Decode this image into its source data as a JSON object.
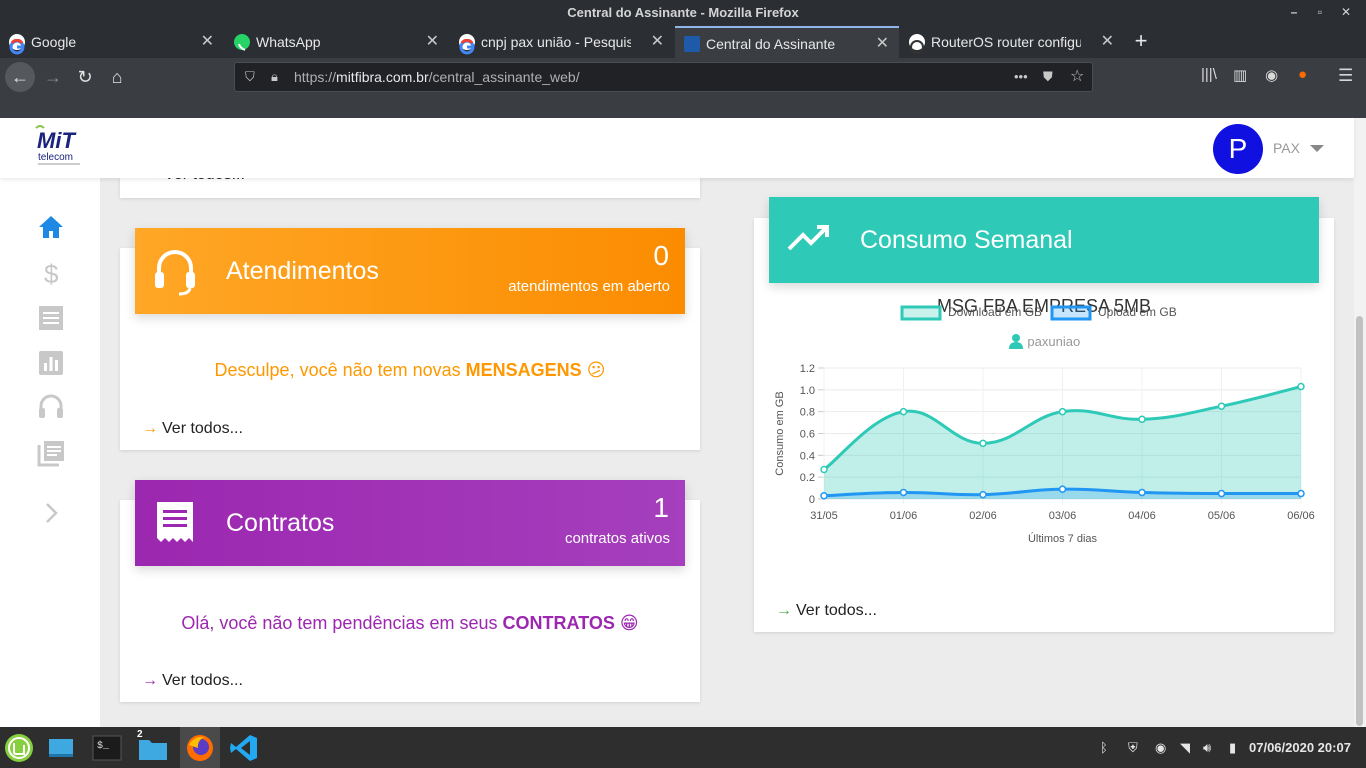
{
  "window": {
    "title": "Central do Assinante - Mozilla Firefox"
  },
  "tabs": [
    {
      "label": "Google",
      "favicon": "google-icon"
    },
    {
      "label": "WhatsApp",
      "favicon": "whatsapp-icon"
    },
    {
      "label": "cnpj pax união - Pesquisa G",
      "favicon": "google-icon"
    },
    {
      "label": "Central do Assinante",
      "favicon": "mitfibra-icon",
      "active": true
    },
    {
      "label": "RouterOS router configura",
      "favicon": "mikrotik-icon"
    }
  ],
  "url": {
    "scheme": "https://",
    "domain": "mitfibra.com.br",
    "path": "/central_assinante_web/"
  },
  "header": {
    "avatar_letter": "P",
    "username": "PAX",
    "logo_text": "MiT",
    "logo_sub": "telecom"
  },
  "colors": {
    "orange": "#ff9800",
    "purple": "#9c27b0",
    "teal": "#2ec9b7",
    "blue_upload": "#2196f3",
    "avatar": "#1010e0"
  },
  "top_card": {
    "link": "Ver todos..."
  },
  "atendimentos": {
    "title": "Atendimentos",
    "count": "0",
    "count_label": "atendimentos em aberto",
    "message_prefix": "Desculpe, você não tem novas ",
    "message_bold": "MENSAGENS",
    "message_emoji": "😕",
    "link": "Ver todos..."
  },
  "contratos": {
    "title": "Contratos",
    "count": "1",
    "count_label": "contratos ativos",
    "message_prefix": "Olá, você não tem pendências em seus ",
    "message_bold": "CONTRATOS",
    "message_emoji": "😁",
    "link": "Ver todos..."
  },
  "consumo": {
    "title": "Consumo Semanal",
    "plan": "MSG FBA EMPRESA 5MB",
    "user": "paxuniao",
    "link": "Ver todos..."
  },
  "chart_data": {
    "type": "area",
    "categories": [
      "31/05",
      "01/06",
      "02/06",
      "03/06",
      "04/06",
      "05/06",
      "06/06"
    ],
    "series": [
      {
        "name": "Download em GB",
        "values": [
          0.27,
          0.8,
          0.51,
          0.8,
          0.73,
          0.85,
          1.03
        ],
        "color": "#2ec9b7"
      },
      {
        "name": "Upload em GB",
        "values": [
          0.03,
          0.06,
          0.04,
          0.09,
          0.06,
          0.05,
          0.05
        ],
        "color": "#2196f3"
      }
    ],
    "ylabel": "Consumo em GB",
    "xlabel": "Últimos 7 dias",
    "ylim": [
      0,
      1.2
    ],
    "yticks": [
      "0",
      "0.2",
      "0.4",
      "0.6",
      "0.8",
      "1.0",
      "1.2"
    ],
    "legend": "top",
    "grid": true
  },
  "taskbar": {
    "datetime": "07/06/2020 20:07",
    "badge": "2"
  }
}
